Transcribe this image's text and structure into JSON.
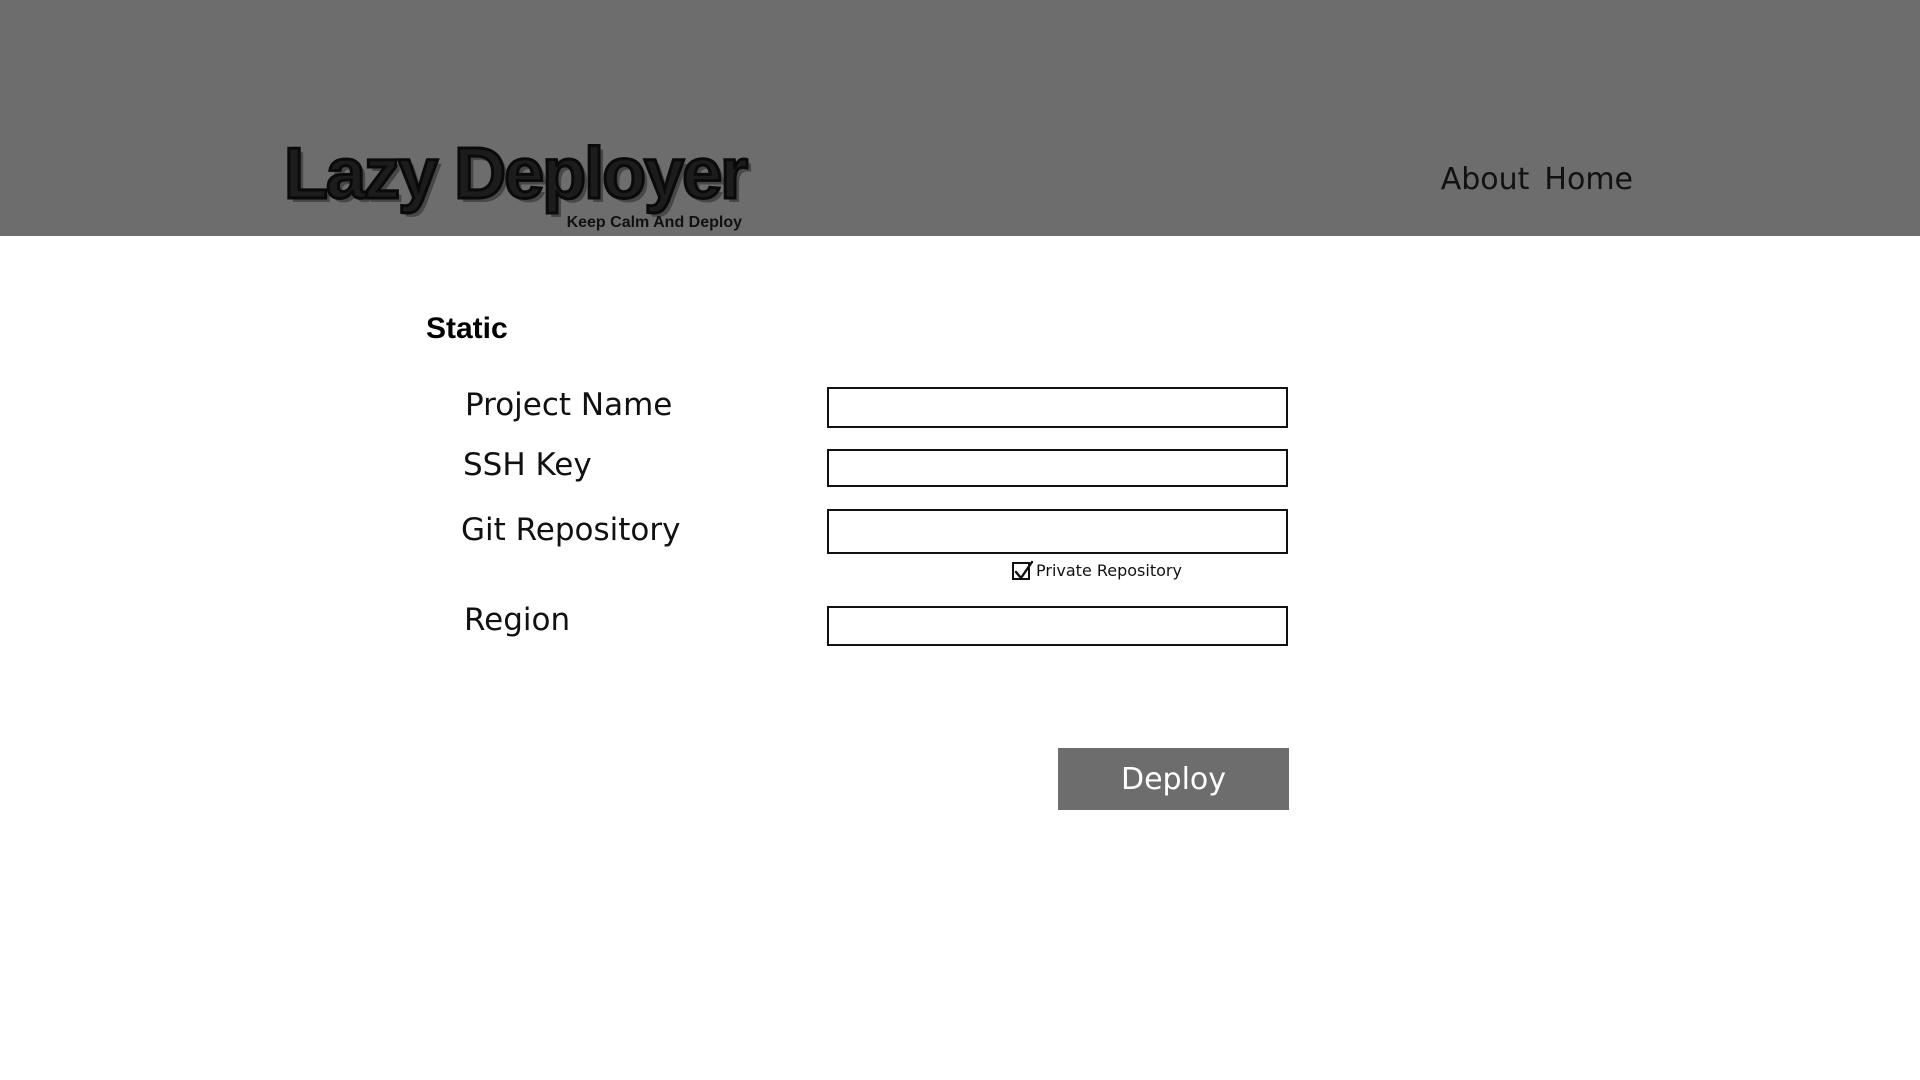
{
  "header": {
    "title": "Lazy Deployer",
    "tagline": "Keep Calm And Deploy",
    "nav": [
      {
        "label": "About"
      },
      {
        "label": "Home"
      }
    ]
  },
  "form": {
    "section_title": "Static",
    "fields": [
      {
        "label": "Project Name",
        "value": "",
        "placeholder": ""
      },
      {
        "label": "SSH Key",
        "value": "",
        "placeholder": ""
      },
      {
        "label": "Git Repository",
        "value": "",
        "placeholder": ""
      },
      {
        "label": "Region",
        "value": "",
        "placeholder": ""
      }
    ],
    "private_repo": {
      "label": "Private Repository",
      "checked": true
    },
    "submit_label": "Deploy"
  },
  "colors": {
    "header_bg": "#6d6d6d",
    "button_bg": "#6d6d6d",
    "button_text": "#ffffff",
    "text": "#111111"
  }
}
